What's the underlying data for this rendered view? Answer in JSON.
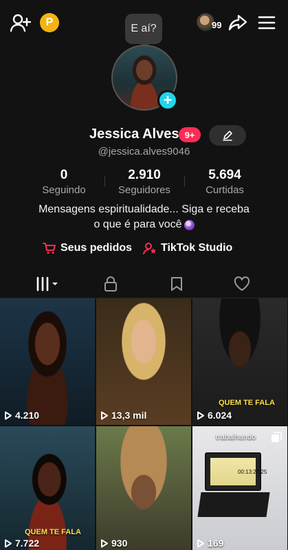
{
  "bubble_text": "E aí?",
  "header": {
    "points_label": "P",
    "friends_count": "99"
  },
  "profile": {
    "name": "Jessica Alves",
    "badge": "9+",
    "handle": "@jessica.alves9046",
    "bio_line1": "Mensagens espiritualidade... Siga e receba",
    "bio_line2": "o que é para você"
  },
  "stats": [
    {
      "value": "0",
      "label": "Seguindo"
    },
    {
      "value": "2.910",
      "label": "Seguidores"
    },
    {
      "value": "5.694",
      "label": "Curtidas"
    }
  ],
  "links": [
    {
      "label": "Seus pedidos",
      "icon": "cart-icon"
    },
    {
      "label": "TikTok Studio",
      "icon": "studio-icon"
    }
  ],
  "tabs": [
    {
      "icon": "grid-icon",
      "active": true
    },
    {
      "icon": "lock-icon"
    },
    {
      "icon": "bookmark-icon"
    },
    {
      "icon": "heart-icon"
    }
  ],
  "videos": [
    {
      "views": "4.210",
      "caption": ""
    },
    {
      "views": "13,3 mil",
      "caption": ""
    },
    {
      "views": "6.024",
      "caption": "QUEM TE FALA"
    },
    {
      "views": "7.722",
      "caption": "QUEM TE FALA"
    },
    {
      "views": "930",
      "caption": ""
    },
    {
      "views": "169",
      "caption": "trabalhando",
      "screen_time": "00:13:23,25"
    }
  ],
  "colors": {
    "accent_pink": "#fe2c55",
    "accent_cyan": "#20d5ec",
    "points_yellow": "#f5b312"
  }
}
